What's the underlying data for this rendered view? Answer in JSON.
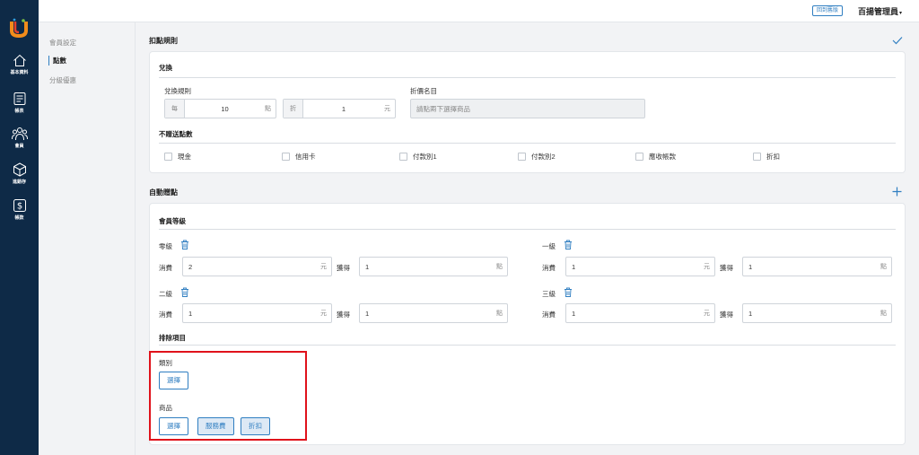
{
  "topbar": {
    "old_version_label": "回到舊版",
    "user_name": "百揚管理員",
    "caret": "▾"
  },
  "rail": [
    {
      "label": "基本資料",
      "icon": "home-icon"
    },
    {
      "label": "帳表",
      "icon": "report-icon"
    },
    {
      "label": "會員",
      "icon": "members-icon"
    },
    {
      "label": "進銷存",
      "icon": "inventory-box-icon"
    },
    {
      "label": "帳款",
      "icon": "dollar-icon"
    }
  ],
  "subnav": [
    {
      "label": "會員設定"
    },
    {
      "label": "點數",
      "active": true
    },
    {
      "label": "分級優惠"
    }
  ],
  "deduct": {
    "title": "扣點規則",
    "exchange": {
      "title": "兌換",
      "rule_label": "兌換規則",
      "per_prefix": "每",
      "per_value": "10",
      "per_suffix": "點",
      "discount_prefix": "折",
      "discount_value": "1",
      "discount_suffix": "元",
      "discount_name_label": "折價名目",
      "discount_name_placeholder": "請點兩下選擇商品"
    },
    "no_points": {
      "title": "不贈送點數",
      "options": [
        "現金",
        "信用卡",
        "付款別1",
        "付款別2",
        "應收帳款",
        "折扣"
      ]
    }
  },
  "auto": {
    "title": "自動贈點",
    "level_title": "會員等級",
    "spend_label": "消費",
    "earn_label": "獲得",
    "yuan": "元",
    "point": "點",
    "levels": [
      {
        "name": "零級",
        "spend": "2",
        "earn": "1"
      },
      {
        "name": "一級",
        "spend": "1",
        "earn": "1"
      },
      {
        "name": "二級",
        "spend": "1",
        "earn": "1"
      },
      {
        "name": "三級",
        "spend": "1",
        "earn": "1"
      }
    ],
    "exclude_title": "排除項目",
    "category_label": "類別",
    "category_select": "選擇",
    "product_label": "商品",
    "product_select": "選擇",
    "product_tags": [
      "服務費",
      "折扣"
    ]
  },
  "colors": {
    "rail": "#0e2a47",
    "accent": "#2f7ec1",
    "highlight": "#e0121b"
  }
}
